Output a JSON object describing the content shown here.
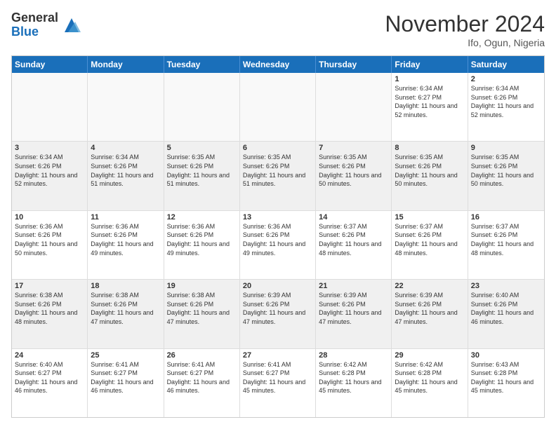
{
  "logo": {
    "general": "General",
    "blue": "Blue"
  },
  "title": "November 2024",
  "location": "Ifo, Ogun, Nigeria",
  "days": [
    "Sunday",
    "Monday",
    "Tuesday",
    "Wednesday",
    "Thursday",
    "Friday",
    "Saturday"
  ],
  "rows": [
    [
      {
        "day": "",
        "info": ""
      },
      {
        "day": "",
        "info": ""
      },
      {
        "day": "",
        "info": ""
      },
      {
        "day": "",
        "info": ""
      },
      {
        "day": "",
        "info": ""
      },
      {
        "day": "1",
        "info": "Sunrise: 6:34 AM\nSunset: 6:27 PM\nDaylight: 11 hours and 52 minutes."
      },
      {
        "day": "2",
        "info": "Sunrise: 6:34 AM\nSunset: 6:26 PM\nDaylight: 11 hours and 52 minutes."
      }
    ],
    [
      {
        "day": "3",
        "info": "Sunrise: 6:34 AM\nSunset: 6:26 PM\nDaylight: 11 hours and 52 minutes."
      },
      {
        "day": "4",
        "info": "Sunrise: 6:34 AM\nSunset: 6:26 PM\nDaylight: 11 hours and 51 minutes."
      },
      {
        "day": "5",
        "info": "Sunrise: 6:35 AM\nSunset: 6:26 PM\nDaylight: 11 hours and 51 minutes."
      },
      {
        "day": "6",
        "info": "Sunrise: 6:35 AM\nSunset: 6:26 PM\nDaylight: 11 hours and 51 minutes."
      },
      {
        "day": "7",
        "info": "Sunrise: 6:35 AM\nSunset: 6:26 PM\nDaylight: 11 hours and 50 minutes."
      },
      {
        "day": "8",
        "info": "Sunrise: 6:35 AM\nSunset: 6:26 PM\nDaylight: 11 hours and 50 minutes."
      },
      {
        "day": "9",
        "info": "Sunrise: 6:35 AM\nSunset: 6:26 PM\nDaylight: 11 hours and 50 minutes."
      }
    ],
    [
      {
        "day": "10",
        "info": "Sunrise: 6:36 AM\nSunset: 6:26 PM\nDaylight: 11 hours and 50 minutes."
      },
      {
        "day": "11",
        "info": "Sunrise: 6:36 AM\nSunset: 6:26 PM\nDaylight: 11 hours and 49 minutes."
      },
      {
        "day": "12",
        "info": "Sunrise: 6:36 AM\nSunset: 6:26 PM\nDaylight: 11 hours and 49 minutes."
      },
      {
        "day": "13",
        "info": "Sunrise: 6:36 AM\nSunset: 6:26 PM\nDaylight: 11 hours and 49 minutes."
      },
      {
        "day": "14",
        "info": "Sunrise: 6:37 AM\nSunset: 6:26 PM\nDaylight: 11 hours and 48 minutes."
      },
      {
        "day": "15",
        "info": "Sunrise: 6:37 AM\nSunset: 6:26 PM\nDaylight: 11 hours and 48 minutes."
      },
      {
        "day": "16",
        "info": "Sunrise: 6:37 AM\nSunset: 6:26 PM\nDaylight: 11 hours and 48 minutes."
      }
    ],
    [
      {
        "day": "17",
        "info": "Sunrise: 6:38 AM\nSunset: 6:26 PM\nDaylight: 11 hours and 48 minutes."
      },
      {
        "day": "18",
        "info": "Sunrise: 6:38 AM\nSunset: 6:26 PM\nDaylight: 11 hours and 47 minutes."
      },
      {
        "day": "19",
        "info": "Sunrise: 6:38 AM\nSunset: 6:26 PM\nDaylight: 11 hours and 47 minutes."
      },
      {
        "day": "20",
        "info": "Sunrise: 6:39 AM\nSunset: 6:26 PM\nDaylight: 11 hours and 47 minutes."
      },
      {
        "day": "21",
        "info": "Sunrise: 6:39 AM\nSunset: 6:26 PM\nDaylight: 11 hours and 47 minutes."
      },
      {
        "day": "22",
        "info": "Sunrise: 6:39 AM\nSunset: 6:26 PM\nDaylight: 11 hours and 47 minutes."
      },
      {
        "day": "23",
        "info": "Sunrise: 6:40 AM\nSunset: 6:26 PM\nDaylight: 11 hours and 46 minutes."
      }
    ],
    [
      {
        "day": "24",
        "info": "Sunrise: 6:40 AM\nSunset: 6:27 PM\nDaylight: 11 hours and 46 minutes."
      },
      {
        "day": "25",
        "info": "Sunrise: 6:41 AM\nSunset: 6:27 PM\nDaylight: 11 hours and 46 minutes."
      },
      {
        "day": "26",
        "info": "Sunrise: 6:41 AM\nSunset: 6:27 PM\nDaylight: 11 hours and 46 minutes."
      },
      {
        "day": "27",
        "info": "Sunrise: 6:41 AM\nSunset: 6:27 PM\nDaylight: 11 hours and 45 minutes."
      },
      {
        "day": "28",
        "info": "Sunrise: 6:42 AM\nSunset: 6:28 PM\nDaylight: 11 hours and 45 minutes."
      },
      {
        "day": "29",
        "info": "Sunrise: 6:42 AM\nSunset: 6:28 PM\nDaylight: 11 hours and 45 minutes."
      },
      {
        "day": "30",
        "info": "Sunrise: 6:43 AM\nSunset: 6:28 PM\nDaylight: 11 hours and 45 minutes."
      }
    ]
  ]
}
